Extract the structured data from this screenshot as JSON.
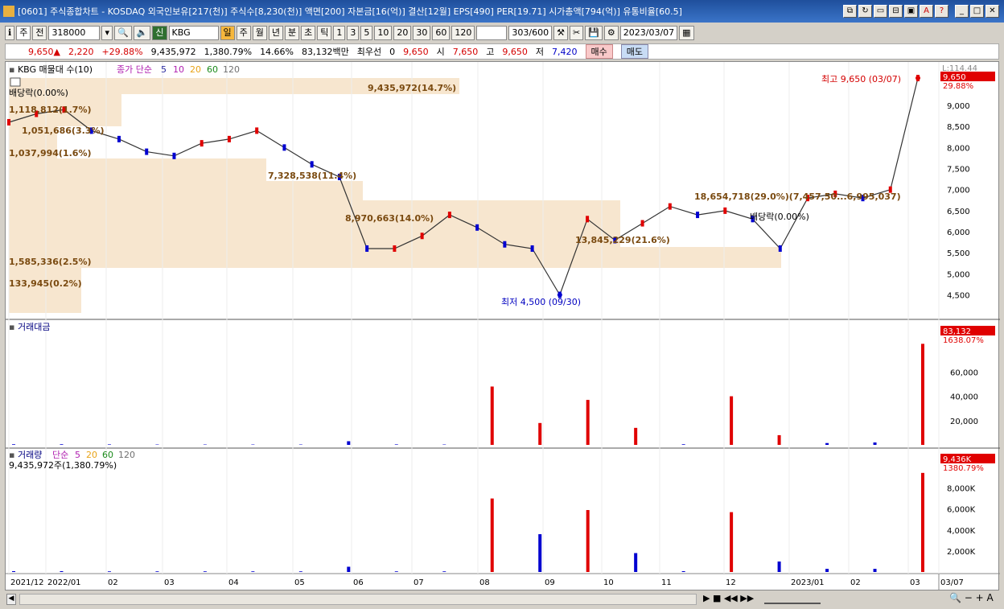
{
  "window": {
    "title": "[0601] 주식종합차트 - KOSDAQ 외국인보유[217(천)] 주식수[8,230(천)] 액면[200] 자본금[16(억)] 결산[12월] EPS[490] PER[19.71] 시가총액[794(억)] 유통비율[60.5]"
  },
  "toolbar": {
    "mode": "주",
    "prev": "전",
    "code": "318000",
    "stock_tag": "신",
    "stock_name": "KBG",
    "periods": [
      "일",
      "주",
      "월",
      "년",
      "분",
      "초",
      "틱"
    ],
    "intervals": [
      "1",
      "3",
      "5",
      "10",
      "20",
      "30",
      "60",
      "120"
    ],
    "count": "303",
    "count_total": "/600",
    "date": "2023/03/07"
  },
  "quote": {
    "price": "9,650",
    "arrow": "▲",
    "change": "2,220",
    "change_pct": "+29.88%",
    "volume": "9,435,972",
    "vol_pct": "1,380.79%",
    "turnover": "14.66%",
    "amount": "83,132백만",
    "best": "최우선",
    "best_val": "0",
    "ask": "9,650",
    "open_l": "시",
    "open": "7,650",
    "high_l": "고",
    "high": "9,650",
    "low_l": "저",
    "low": "7,420",
    "buy": "매수",
    "sell": "매도"
  },
  "panels": {
    "price": {
      "legend_name": "KBG 매물대 수(10)",
      "ma_label": "종가 단순",
      "ma_periods": [
        "5",
        "10",
        "20",
        "60",
        "120"
      ],
      "profile_labels": [
        "9,435,972(14.7%)",
        "1,118,812(1.7%)",
        "1,051,686(3.3%)",
        "1,037,994(1.6%)",
        "7,328,538(11.4%)",
        "8,970,663(14.0%)",
        "13,845,229(21.6%)",
        "18,654,718(29.0%)(7,457,50...6,995,037)",
        "1,585,336(2.5%)",
        "133,945(0.2%)"
      ],
      "dividend1": "배당락(0.00%)",
      "dividend2": "배당락(0.00%)",
      "high_note": "최고 9,650 (03/07)",
      "low_note": "최저 4,500 (09/30)",
      "yaxis": [
        "9,000",
        "8,500",
        "8,000",
        "7,500",
        "7,000",
        "6,500",
        "6,000",
        "5,500",
        "5,000",
        "4,500"
      ],
      "corner": "L:114.44",
      "last": "9,650",
      "last_pct": "29.88%"
    },
    "amount": {
      "legend_name": "거래대금",
      "yaxis": [
        "60,000",
        "40,000",
        "20,000"
      ],
      "last": "83,132",
      "last_pct": "1638.07%"
    },
    "volume": {
      "legend_name": "거래량",
      "ma_label": "단순",
      "ma_periods": [
        "5",
        "20",
        "60",
        "120"
      ],
      "value_text": "9,435,972주(1,380.79%)",
      "yaxis": [
        "8,000K",
        "6,000K",
        "4,000K",
        "2,000K"
      ],
      "last": "9,436K",
      "last_pct": "1380.79%"
    }
  },
  "xaxis": [
    "2021/12",
    "2022/01",
    "02",
    "03",
    "04",
    "05",
    "06",
    "07",
    "08",
    "09",
    "10",
    "11",
    "12",
    "2023/01",
    "02",
    "03",
    "03/07"
  ],
  "colors": {
    "up": "#e00000",
    "down": "#0000d0",
    "ma5": "#2a2aa0",
    "ma10": "#b020b0",
    "ma20": "#e8a317",
    "ma60": "#1a8a1a",
    "ma120": "#707070",
    "profile": "#f7e6cf"
  },
  "chart_data": [
    {
      "type": "line",
      "title": "KBG 매물대 수(10)",
      "series": [
        {
          "name": "종가",
          "values": [
            8600,
            8800,
            8900,
            8400,
            8200,
            7900,
            7800,
            8100,
            8200,
            8400,
            8000,
            7600,
            7300,
            5600,
            5600,
            5900,
            6400,
            6100,
            5700,
            5600,
            4500,
            6300,
            5800,
            6200,
            6600,
            6400,
            6500,
            6300,
            5600,
            6800,
            6900,
            6800,
            7000,
            9650
          ]
        }
      ],
      "markers": {
        "max": {
          "label": "최고 9,650 (03/07)",
          "y": 9650
        },
        "min": {
          "label": "최저 4,500 (09/30)",
          "y": 4500
        }
      },
      "ylim": [
        4300,
        9650
      ]
    },
    {
      "type": "bar",
      "title": "거래대금",
      "series": [
        {
          "name": "거래대금",
          "values": [
            500,
            500,
            400,
            300,
            300,
            300,
            300,
            3000,
            400,
            300,
            48000,
            18000,
            37000,
            14000,
            500,
            40000,
            8000,
            1500,
            2000,
            83132
          ]
        }
      ],
      "ylim": [
        0,
        90000
      ]
    },
    {
      "type": "bar",
      "title": "거래량",
      "series": [
        {
          "name": "거래량",
          "values": [
            80,
            80,
            60,
            60,
            60,
            60,
            60,
            500,
            60,
            60,
            7000,
            3600,
            5900,
            1800,
            80,
            5700,
            1000,
            300,
            300,
            9436
          ]
        }
      ],
      "ylim": [
        0,
        9500
      ]
    }
  ]
}
